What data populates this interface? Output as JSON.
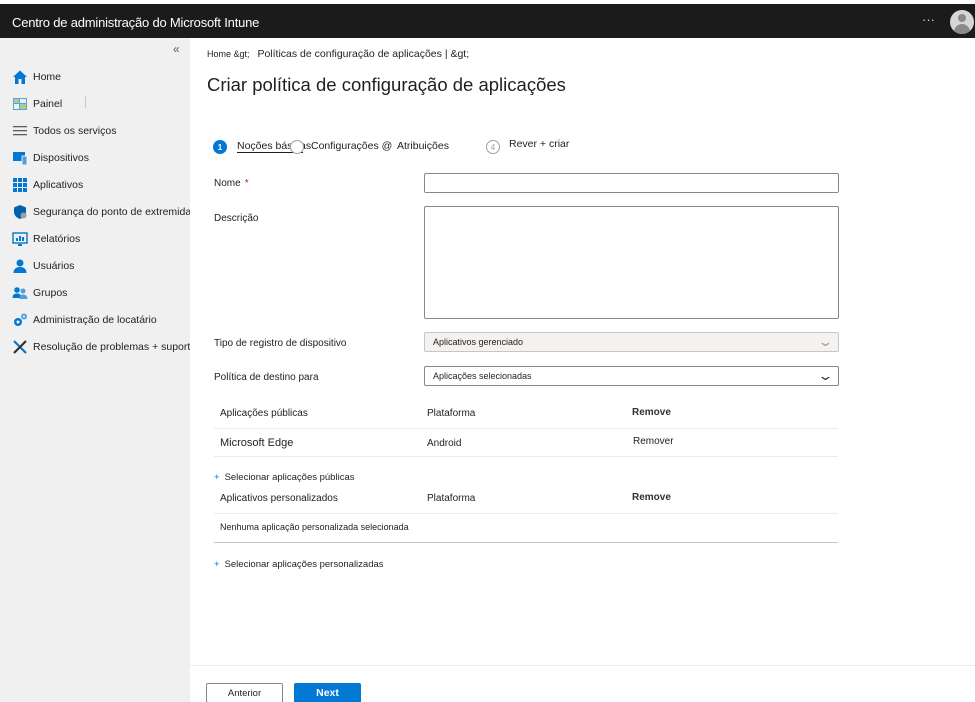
{
  "header": {
    "title": "Centro de administração do Microsoft Intune",
    "more": "···",
    "avatar_icon": "user-avatar-icon"
  },
  "sidebar": {
    "collapse": "«",
    "items": [
      {
        "label": "Home",
        "icon": "home-icon"
      },
      {
        "label": "Painel",
        "icon": "dashboard-icon"
      },
      {
        "label": "Todos os serviços",
        "icon": "list-icon"
      },
      {
        "label": "Dispositivos",
        "icon": "devices-icon"
      },
      {
        "label": "Aplicativos",
        "icon": "apps-grid-icon"
      },
      {
        "label": "Segurança do ponto de extremidade",
        "icon": "shield-icon"
      },
      {
        "label": "Relatórios",
        "icon": "reports-icon"
      },
      {
        "label": "Usuários",
        "icon": "user-icon"
      },
      {
        "label": "Grupos",
        "icon": "groups-icon"
      },
      {
        "label": "Administração de locatário",
        "icon": "tenant-admin-icon"
      },
      {
        "label": "Resolução de problemas + suporte",
        "icon": "troubleshoot-icon"
      }
    ]
  },
  "breadcrumb": {
    "home": "Home &gt;",
    "current": "Políticas de configuração de aplicações | &gt;"
  },
  "page": {
    "title": "Criar política de configuração de aplicações"
  },
  "wizard": {
    "steps": [
      {
        "num": "1",
        "label": "Noções básicas"
      },
      {
        "num": "",
        "label": "Configurações @"
      },
      {
        "num": "",
        "label": "Atribuições"
      },
      {
        "num": "4",
        "label": "Rever + criar"
      }
    ]
  },
  "form": {
    "name_label": "Nome",
    "required_mark": "*",
    "name_value": "",
    "description_label": "Descrição",
    "description_value": "",
    "enrollment_label": "Tipo de registro de dispositivo",
    "enrollment_value": "Aplicativos gerenciado",
    "target_label": "Política de destino para",
    "target_value": "Aplicações selecionadas"
  },
  "public_apps": {
    "headers": [
      "Aplicações públicas",
      "Plataforma",
      "Remove"
    ],
    "rows": [
      {
        "name": "Microsoft Edge",
        "platform": "Android",
        "action": "Remover"
      }
    ],
    "add_link": "Selecionar aplicações públicas"
  },
  "custom_apps": {
    "headers": [
      "Aplicativos personalizados",
      "Plataforma",
      "Remove"
    ],
    "empty": "Nenhuma aplicação personalizada selecionada",
    "add_link": "Selecionar aplicações personalizadas"
  },
  "footer": {
    "prev": "Anterior",
    "next": "Next"
  },
  "colors": {
    "accent": "#0078d4",
    "topbar": "#1b1b1b",
    "sidebar": "#f0f0f0",
    "required": "#a4262c"
  }
}
